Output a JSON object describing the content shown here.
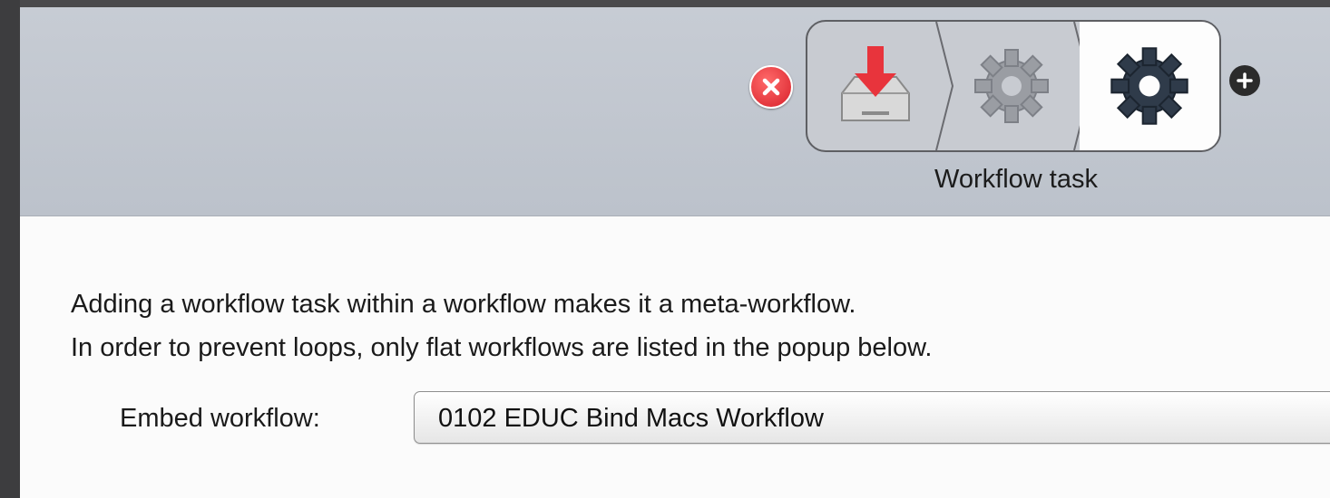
{
  "toolbar": {
    "remove_icon": "remove-circle-icon",
    "add_icon": "add-circle-icon",
    "tasks": [
      {
        "icon": "download-tray-icon"
      },
      {
        "icon": "gear-icon"
      },
      {
        "icon": "gear-icon"
      }
    ],
    "selected_task_label": "Workflow task"
  },
  "content": {
    "description_line1": "Adding a workflow task within a workflow makes it a meta-workflow.",
    "description_line2": "In order to prevent loops, only flat workflows are listed in the popup below.",
    "embed_label": "Embed workflow:",
    "embed_value": "0102 EDUC Bind Macs Workflow"
  },
  "colors": {
    "toolbar_bg": "#c3c8d0",
    "content_bg": "#fbfbfb",
    "remove_red": "#d8202a"
  }
}
